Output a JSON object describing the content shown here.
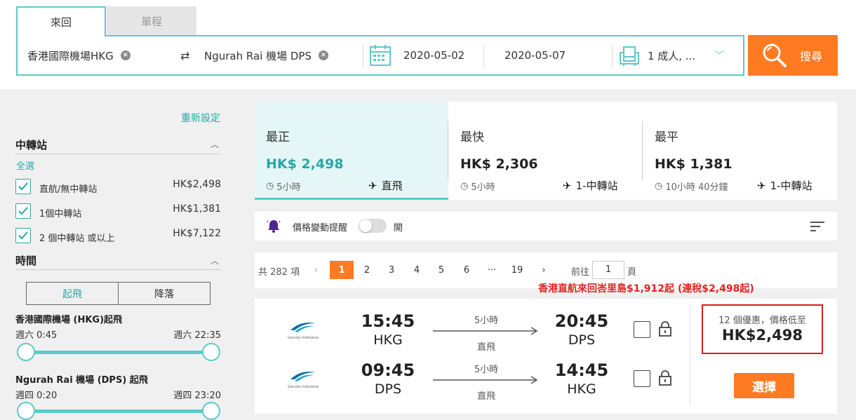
{
  "colors": {
    "accent": "#5fc9c9",
    "orange": "#ff7a21",
    "teal_text": "#2aa6a6",
    "promo_red": "#e52222"
  },
  "tabs": {
    "roundtrip": "來回",
    "oneway": "單程"
  },
  "search": {
    "origin": "香港國際機場HKG",
    "destination": "Ngurah Rai 機場 DPS",
    "depart_date": "2020-05-02",
    "return_date": "2020-05-07",
    "passengers": "1 成人, ...",
    "search_label": "搜尋"
  },
  "filters": {
    "reset": "重新設定",
    "stops": {
      "title": "中轉站",
      "select_all": "全選",
      "options": [
        {
          "label": "直航/無中轉站",
          "price": "HK$2,498",
          "checked": true
        },
        {
          "label": "1個中轉站",
          "price": "HK$1,381",
          "checked": true
        },
        {
          "label": "2 個中轉站 或以上",
          "price": "HK$7,122",
          "checked": true
        }
      ]
    },
    "time": {
      "title": "時間",
      "takeoff": "起飛",
      "landing": "降落",
      "origin_label": "香港國際機場 (HKG)起飛",
      "origin_min": "週六 0:45",
      "origin_max": "週六 22:35",
      "dest_label": "Ngurah Rai 機場 (DPS) 起飛",
      "dest_min": "週四 0:20",
      "dest_max": "週四 23:20"
    }
  },
  "summary": [
    {
      "title": "最正",
      "price": "HK$ 2,498",
      "duration": "5小時",
      "stops": "直飛"
    },
    {
      "title": "最快",
      "price": "HK$ 2,306",
      "duration": "5小時",
      "stops": "1-中轉站"
    },
    {
      "title": "最平",
      "price": "HK$ 1,381",
      "duration": "10小時 40分鐘",
      "stops": "1-中轉站"
    }
  ],
  "alert": {
    "label": "價格變動提醒",
    "state": "開"
  },
  "pagination": {
    "total": "共 282 項",
    "pages": [
      "1",
      "2",
      "3",
      "4",
      "5",
      "6",
      "···",
      "19"
    ],
    "current": "1",
    "goto_label": "前往",
    "goto_value": "1",
    "page_suffix": "頁"
  },
  "promo": "香港直航來回峇里島$1,912起 (連稅$2,498起)",
  "result": {
    "airline_logo_text": "Garuda Indonesia",
    "outbound": {
      "depart_time": "15:45",
      "depart_code": "HKG",
      "arrive_time": "20:45",
      "arrive_code": "DPS",
      "duration": "5小時",
      "type": "直飛"
    },
    "inbound": {
      "depart_time": "09:45",
      "depart_code": "DPS",
      "arrive_time": "14:45",
      "arrive_code": "HKG",
      "duration": "5小時",
      "type": "直飛"
    },
    "deal_label": "12 個優惠，價格低至",
    "deal_price": "HK$2,498",
    "select_label": "選擇"
  }
}
